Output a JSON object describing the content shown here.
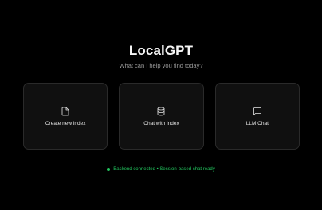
{
  "app": {
    "title": "LocalGPT",
    "subtitle": "What can I help you find today?"
  },
  "cards": [
    {
      "label": "Create new index",
      "icon": "file-icon"
    },
    {
      "label": "Chat with index",
      "icon": "database-icon"
    },
    {
      "label": "LLM Chat",
      "icon": "message-icon"
    }
  ],
  "status": {
    "text": "Backend connected • Session-based chat ready",
    "color": "#22c55e"
  },
  "colors": {
    "background": "#000000",
    "card_background": "#101010",
    "card_border": "#2a2a2a",
    "status_green": "#22c55e"
  }
}
